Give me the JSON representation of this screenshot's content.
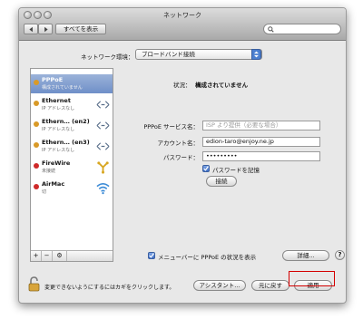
{
  "window": {
    "title": "ネットワーク"
  },
  "toolbar": {
    "show_all": "すべてを表示",
    "search_placeholder": ""
  },
  "location": {
    "label": "ネットワーク環境：",
    "value": "ブロードバンド接続"
  },
  "services": [
    {
      "name": "PPPoE",
      "status": "構成されていません",
      "dot_color": "#d99a28",
      "icon": "none"
    },
    {
      "name": "Ethernet",
      "status": "IP アドレスなし",
      "dot_color": "#d99a28",
      "icon": "ethernet-icon"
    },
    {
      "name": "Ethern… (en2)",
      "status": "IP アドレスなし",
      "dot_color": "#d99a28",
      "icon": "ethernet-icon"
    },
    {
      "name": "Ethern… (en3)",
      "status": "IP アドレスなし",
      "dot_color": "#d99a28",
      "icon": "ethernet-icon"
    },
    {
      "name": "FireWire",
      "status": "未接続",
      "dot_color": "#cf2a2a",
      "icon": "firewire-icon"
    },
    {
      "name": "AirMac",
      "status": "切",
      "dot_color": "#cf2a2a",
      "icon": "wifi-icon"
    }
  ],
  "sidebar_footer": {
    "add": "+",
    "remove": "−",
    "gear": "⚙"
  },
  "detail": {
    "status_label": "状況：",
    "status_value": "構成されていません",
    "service_name_label": "PPPoE サービス名：",
    "service_name_placeholder": "ISP より提供（必要な場合）",
    "account_label": "アカウント名：",
    "account_value": "edion-taro@enjoy.ne.jp",
    "password_label": "パスワード：",
    "password_value": "•••••••••",
    "remember_label": "パスワードを記憶",
    "connect_button": "接続",
    "menubar_label": "メニューバーに PPPoE の状況を表示",
    "advanced_button": "詳細...",
    "help": "?"
  },
  "footer": {
    "lock_text": "変更できないようにするにはカギをクリックします。",
    "assistant_button": "アシスタント...",
    "revert_button": "元に戻す",
    "apply_button": "適用"
  },
  "colors": {
    "accent": "#4a7fd0",
    "highlight": "#d40000",
    "selection": "#7f9dcf"
  }
}
